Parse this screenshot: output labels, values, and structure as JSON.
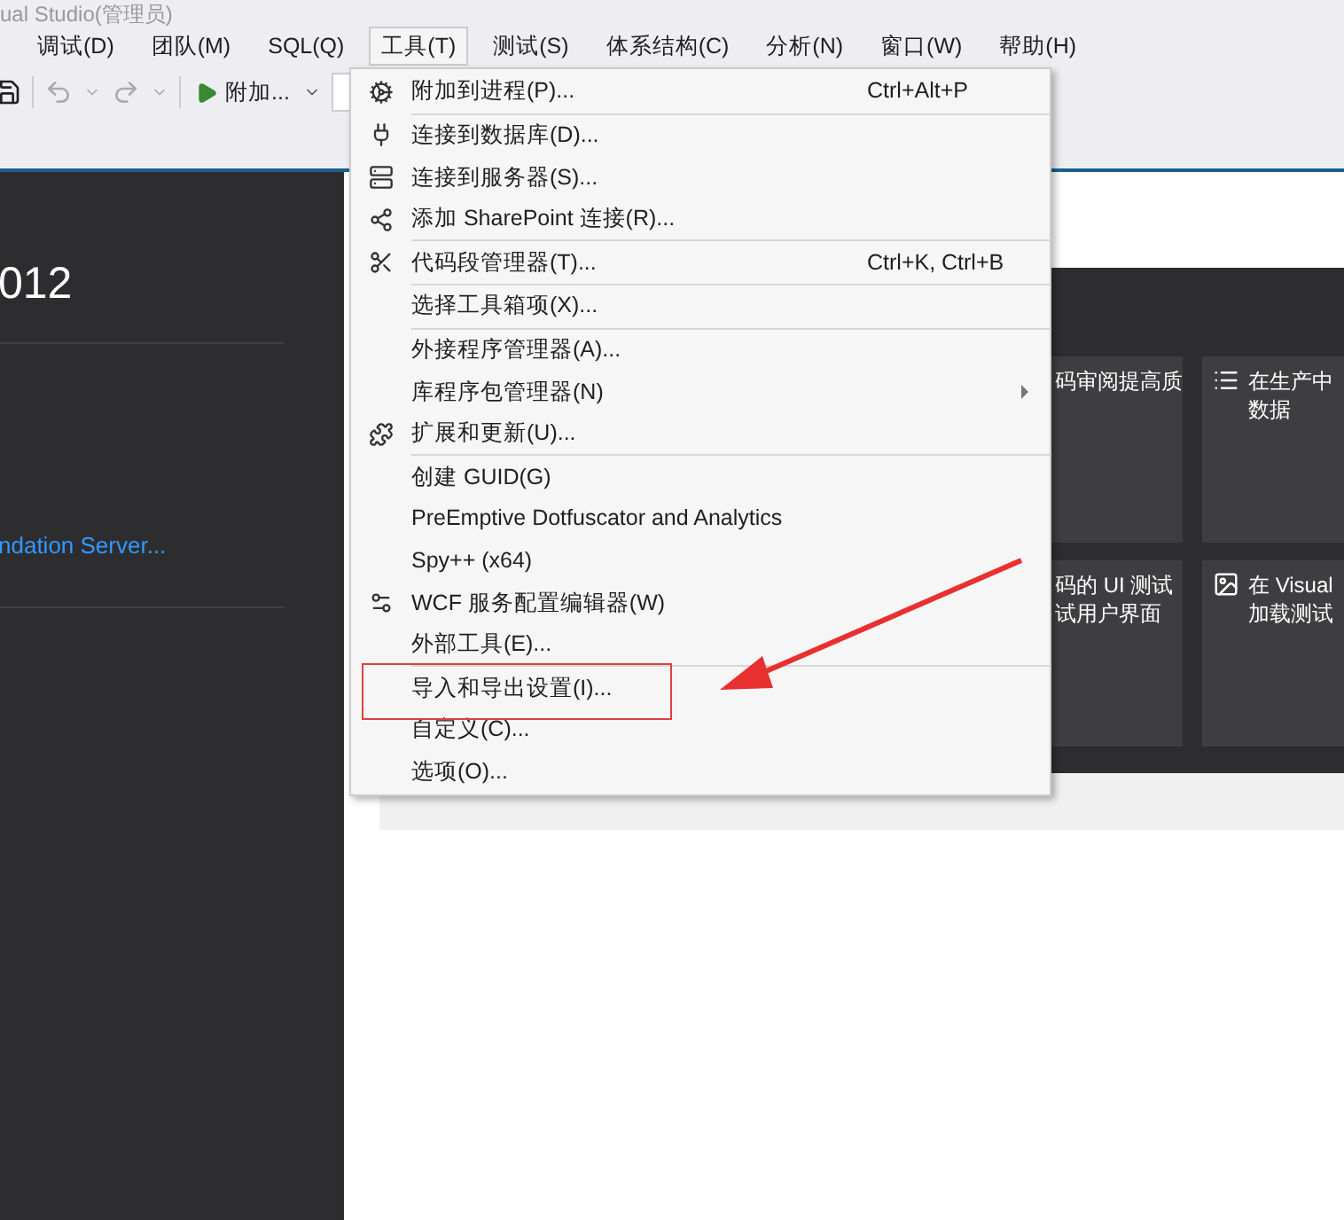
{
  "window": {
    "title": "ual Studio(管理员)"
  },
  "menu_bar": [
    {
      "label": "调试(D)",
      "selected": false
    },
    {
      "label": "团队(M)",
      "selected": false
    },
    {
      "label": "SQL(Q)",
      "selected": false
    },
    {
      "label": "工具(T)",
      "selected": true
    },
    {
      "label": "测试(S)",
      "selected": false
    },
    {
      "label": "体系结构(C)",
      "selected": false
    },
    {
      "label": "分析(N)",
      "selected": false
    },
    {
      "label": "窗口(W)",
      "selected": false
    },
    {
      "label": "帮助(H)",
      "selected": false
    }
  ],
  "toolbar": {
    "run_button": "附加..."
  },
  "start_page": {
    "title": "012",
    "link": "ndation Server...",
    "tiles": [
      {
        "text": "码审阅提高质"
      },
      {
        "text": "在生产中",
        "text_2": "数据"
      },
      {
        "text": "码的 UI 测试",
        "text_2": "试用户界面"
      },
      {
        "text": "在 Visual",
        "text_2": "加载测试"
      }
    ]
  },
  "tools_menu": {
    "groups": [
      [
        {
          "label": "附加到进程(P)...",
          "shortcut": "Ctrl+Alt+P",
          "submenu": false
        }
      ],
      [
        {
          "label": "连接到数据库(D)...",
          "submenu": false
        },
        {
          "label": "连接到服务器(S)...",
          "submenu": false
        },
        {
          "label": "添加 SharePoint 连接(R)...",
          "submenu": false
        }
      ],
      [
        {
          "label": "代码段管理器(T)...",
          "shortcut": "Ctrl+K, Ctrl+B",
          "submenu": false
        }
      ],
      [
        {
          "label": "选择工具箱项(X)...",
          "submenu": false
        }
      ],
      [
        {
          "label": "外接程序管理器(A)...",
          "submenu": false
        },
        {
          "label": "库程序包管理器(N)",
          "submenu": true
        },
        {
          "label": "扩展和更新(U)...",
          "submenu": false
        }
      ],
      [
        {
          "label": "创建 GUID(G)",
          "submenu": false
        },
        {
          "label": "PreEmptive Dotfuscator and Analytics",
          "submenu": false
        },
        {
          "label": "Spy++ (x64)",
          "submenu": false
        },
        {
          "label": "WCF 服务配置编辑器(W)",
          "submenu": false
        },
        {
          "label": "外部工具(E)...",
          "submenu": false
        }
      ],
      [
        {
          "label": "导入和导出设置(I)...",
          "submenu": false
        },
        {
          "label": "自定义(C)...",
          "submenu": false
        },
        {
          "label": "选项(O)...",
          "submenu": false
        }
      ]
    ]
  }
}
